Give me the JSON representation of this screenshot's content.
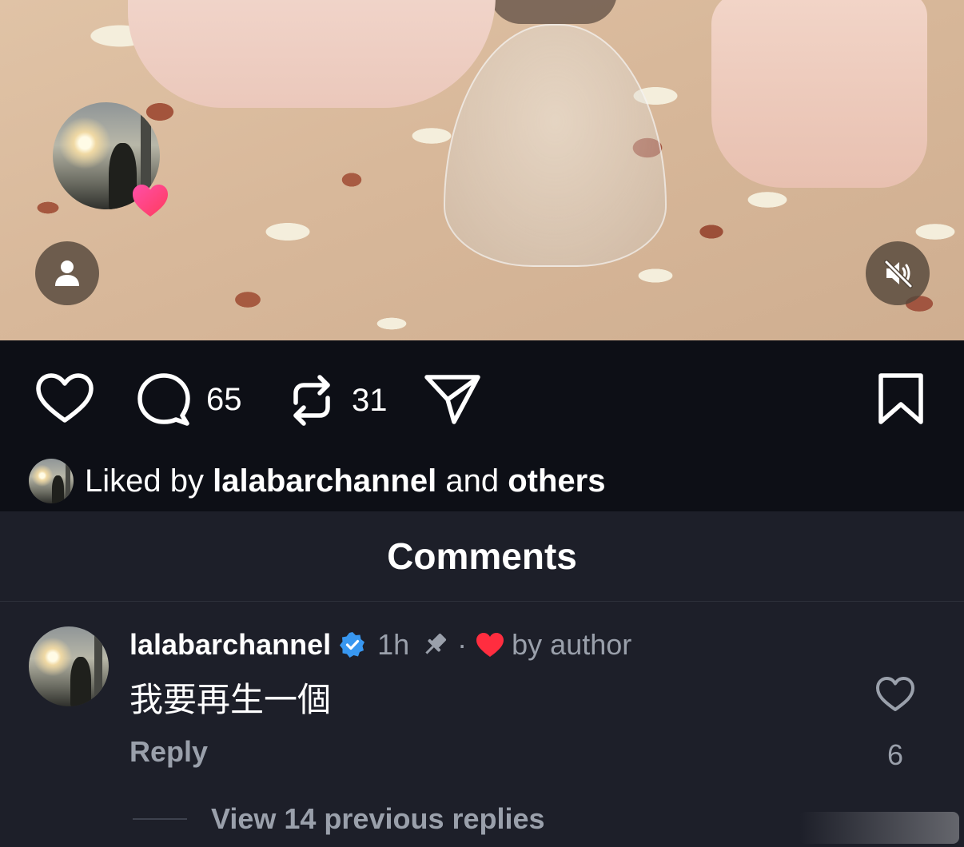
{
  "media": {
    "story_avatar_icon": "user-avatar-photo",
    "heart_badge_icon": "heart-icon",
    "profile_button_icon": "person-icon",
    "mute_button_icon": "speaker-muted-icon"
  },
  "actions": {
    "like_icon": "heart-outline-icon",
    "comment_icon": "comment-bubble-icon",
    "comment_count": "65",
    "repost_icon": "repost-icon",
    "repost_count": "31",
    "share_icon": "send-icon",
    "save_icon": "bookmark-icon"
  },
  "liked_by": {
    "prefix": "Liked by ",
    "user": "lalabarchannel",
    "middle": " and ",
    "others": "others"
  },
  "comments": {
    "title": "Comments",
    "items": [
      {
        "username": "lalabarchannel",
        "verified": true,
        "time": "1h",
        "separator": "·",
        "liked_by_author_text": "by author",
        "text": "我要再生一個",
        "reply_label": "Reply",
        "like_count": "6",
        "view_replies": "View 14 previous replies"
      }
    ]
  },
  "colors": {
    "background": "#0d0f16",
    "sheet": "#1d1f29",
    "verified_blue": "#3897f0",
    "author_heart_red": "#ff2d3f",
    "muted_text": "#9aa0ab"
  }
}
